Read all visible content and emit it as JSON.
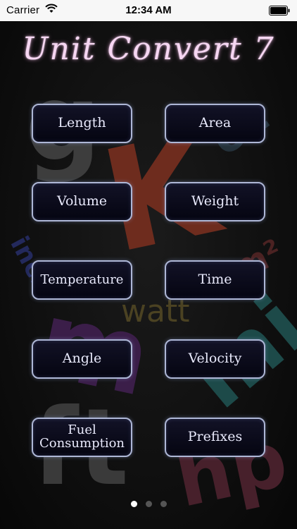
{
  "status_bar": {
    "carrier": "Carrier",
    "time": "12:34 AM",
    "wifi_icon": "wifi-icon",
    "battery_icon": "battery-icon"
  },
  "title": "Unit Convert 7",
  "background_letters": {
    "g": "g",
    "k": "K",
    "oz": "oz",
    "inch": "inch",
    "m2": "m²",
    "watt": "watt",
    "mi": "mi",
    "m": "m",
    "ft": "ft",
    "hp": "hp"
  },
  "buttons": {
    "length": "Length",
    "area": "Area",
    "volume": "Volume",
    "weight": "Weight",
    "temperature": "Temperature",
    "time": "Time",
    "angle": "Angle",
    "velocity": "Velocity",
    "fuel_consumption": "Fuel\nConsumption",
    "prefixes": "Prefixes"
  },
  "page_indicator": {
    "pages": 3,
    "current": 1
  },
  "colors": {
    "title": "#f6d6f2",
    "button_border": "#aeb7d6",
    "button_text": "#e9eafc",
    "status_bar_bg": "#f7f7f7"
  }
}
